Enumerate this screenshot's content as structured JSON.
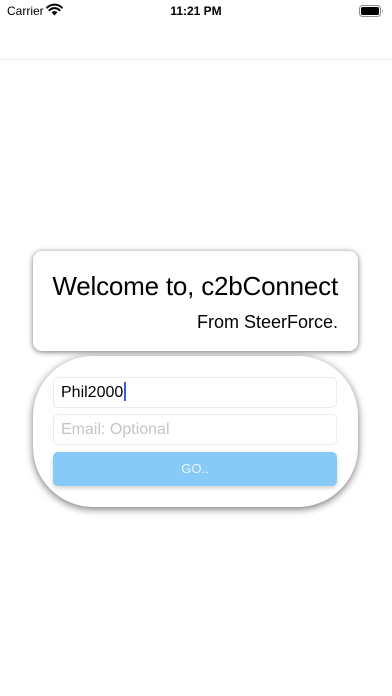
{
  "status_bar": {
    "carrier": "Carrier",
    "time": "11:21 PM"
  },
  "welcome": {
    "title": "Welcome to, c2bConnect",
    "subtitle": "From SteerForce."
  },
  "login": {
    "username_value": "Phil2000",
    "email_placeholder": "Email: Optional",
    "go_label": "GO.."
  },
  "colors": {
    "button": "#87c9f7",
    "caret": "#3b59e6"
  },
  "icons": [
    "wifi-icon",
    "battery-icon"
  ]
}
